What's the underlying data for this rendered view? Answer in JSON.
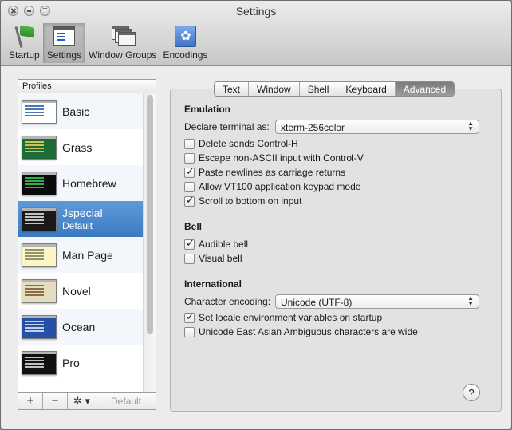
{
  "window": {
    "title": "Settings"
  },
  "toolbar": {
    "items": [
      {
        "label": "Startup",
        "icon": "startup-flag-icon"
      },
      {
        "label": "Settings",
        "icon": "settings-window-icon",
        "selected": true
      },
      {
        "label": "Window Groups",
        "icon": "window-groups-icon"
      },
      {
        "label": "Encodings",
        "icon": "encodings-flag-icon"
      }
    ]
  },
  "profiles": {
    "header": "Profiles",
    "items": [
      {
        "name": "Basic",
        "color": "#2b5fa8"
      },
      {
        "name": "Grass",
        "color": "#d44030"
      },
      {
        "name": "Homebrew",
        "color": "#2aa845"
      },
      {
        "name": "Jspecial",
        "sub": "Default",
        "color": "#e0e0e0",
        "selected": true
      },
      {
        "name": "Man Page",
        "color": "#808060"
      },
      {
        "name": "Novel",
        "color": "#7a5a30"
      },
      {
        "name": "Ocean",
        "color": "#e0e8f8"
      },
      {
        "name": "Pro",
        "color": "#e0e0e0"
      }
    ],
    "buttons": {
      "add": "+",
      "remove": "−",
      "gear": "✲ ▾",
      "default": "Default"
    }
  },
  "tabs": [
    {
      "label": "Text"
    },
    {
      "label": "Window"
    },
    {
      "label": "Shell"
    },
    {
      "label": "Keyboard"
    },
    {
      "label": "Advanced",
      "active": true
    }
  ],
  "emulation": {
    "title": "Emulation",
    "declare_label": "Declare terminal as:",
    "declare_value": "xterm-256color",
    "options": [
      {
        "label": "Delete sends Control-H",
        "checked": false
      },
      {
        "label": "Escape non-ASCII input with Control-V",
        "checked": false
      },
      {
        "label": "Paste newlines as carriage returns",
        "checked": true
      },
      {
        "label": "Allow VT100 application keypad mode",
        "checked": false
      },
      {
        "label": "Scroll to bottom on input",
        "checked": true
      }
    ]
  },
  "bell": {
    "title": "Bell",
    "options": [
      {
        "label": "Audible bell",
        "checked": true
      },
      {
        "label": "Visual bell",
        "checked": false
      }
    ]
  },
  "international": {
    "title": "International",
    "encoding_label": "Character encoding:",
    "encoding_value": "Unicode (UTF-8)",
    "options": [
      {
        "label": "Set locale environment variables on startup",
        "checked": true
      },
      {
        "label": "Unicode East Asian Ambiguous characters are wide",
        "checked": false
      }
    ]
  },
  "help_label": "?"
}
